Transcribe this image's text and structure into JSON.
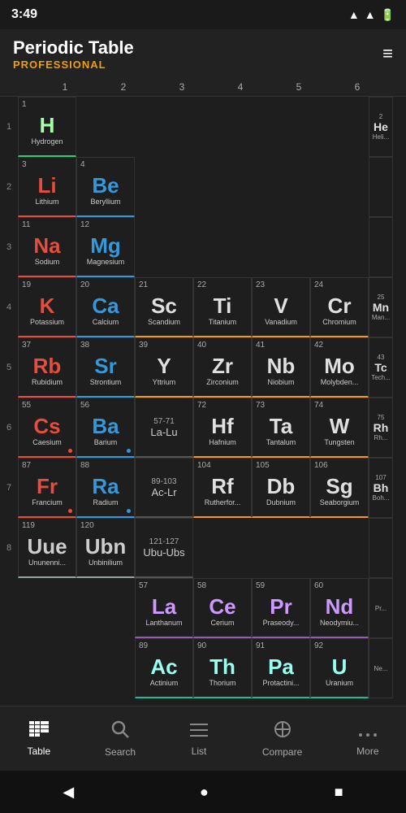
{
  "statusBar": {
    "time": "3:49"
  },
  "header": {
    "title": "Periodic Table",
    "subtitle": "PROFESSIONAL",
    "filterLabel": "filter"
  },
  "columns": [
    "1",
    "2",
    "3",
    "4",
    "5",
    "6"
  ],
  "rows": [
    {
      "rowNum": "1",
      "cells": [
        {
          "number": "1",
          "symbol": "H",
          "name": "Hydrogen",
          "type": "nonmetal",
          "col": 1
        },
        {
          "number": "",
          "symbol": "",
          "name": "",
          "type": "empty",
          "col": 2
        },
        {
          "number": "",
          "symbol": "",
          "name": "",
          "type": "empty",
          "col": 3
        },
        {
          "number": "",
          "symbol": "",
          "name": "",
          "type": "empty",
          "col": 4
        },
        {
          "number": "",
          "symbol": "",
          "name": "",
          "type": "empty",
          "col": 5
        },
        {
          "number": "",
          "symbol": "",
          "name": "",
          "type": "empty",
          "col": 6
        }
      ]
    },
    {
      "rowNum": "2",
      "cells": [
        {
          "number": "3",
          "symbol": "Li",
          "name": "Lithium",
          "type": "alkali-metal",
          "col": 1
        },
        {
          "number": "4",
          "symbol": "Be",
          "name": "Beryllium",
          "type": "alkaline-earth",
          "col": 2
        },
        {
          "number": "",
          "symbol": "",
          "name": "",
          "type": "empty",
          "col": 3
        },
        {
          "number": "",
          "symbol": "",
          "name": "",
          "type": "empty",
          "col": 4
        },
        {
          "number": "",
          "symbol": "",
          "name": "",
          "type": "empty",
          "col": 5
        },
        {
          "number": "",
          "symbol": "",
          "name": "",
          "type": "empty",
          "col": 6
        }
      ]
    },
    {
      "rowNum": "3",
      "cells": [
        {
          "number": "11",
          "symbol": "Na",
          "name": "Sodium",
          "type": "alkali-metal",
          "col": 1
        },
        {
          "number": "12",
          "symbol": "Mg",
          "name": "Magnesium",
          "type": "alkaline-earth",
          "col": 2
        },
        {
          "number": "",
          "symbol": "",
          "name": "",
          "type": "empty",
          "col": 3
        },
        {
          "number": "",
          "symbol": "",
          "name": "",
          "type": "empty",
          "col": 4
        },
        {
          "number": "",
          "symbol": "",
          "name": "",
          "type": "empty",
          "col": 5
        },
        {
          "number": "",
          "symbol": "",
          "name": "",
          "type": "empty",
          "col": 6
        }
      ]
    },
    {
      "rowNum": "4",
      "cells": [
        {
          "number": "19",
          "symbol": "K",
          "name": "Potassium",
          "type": "alkali-metal",
          "col": 1
        },
        {
          "number": "20",
          "symbol": "Ca",
          "name": "Calcium",
          "type": "alkaline-earth",
          "col": 2
        },
        {
          "number": "21",
          "symbol": "Sc",
          "name": "Scandium",
          "type": "transition",
          "col": 3
        },
        {
          "number": "22",
          "symbol": "Ti",
          "name": "Titanium",
          "type": "transition",
          "col": 4
        },
        {
          "number": "23",
          "symbol": "V",
          "name": "Vanadium",
          "type": "transition",
          "col": 5
        },
        {
          "number": "24",
          "symbol": "Cr",
          "name": "Chromium",
          "type": "transition",
          "col": 6
        }
      ]
    },
    {
      "rowNum": "5",
      "cells": [
        {
          "number": "37",
          "symbol": "Rb",
          "name": "Rubidium",
          "type": "alkali-metal",
          "col": 1
        },
        {
          "number": "38",
          "symbol": "Sr",
          "name": "Strontium",
          "type": "alkaline-earth",
          "col": 2
        },
        {
          "number": "39",
          "symbol": "Y",
          "name": "Yttrium",
          "type": "transition",
          "col": 3
        },
        {
          "number": "40",
          "symbol": "Zr",
          "name": "Zirconium",
          "type": "transition",
          "col": 4
        },
        {
          "number": "41",
          "symbol": "Nb",
          "name": "Niobium",
          "type": "transition",
          "col": 5
        },
        {
          "number": "42",
          "symbol": "Mo",
          "name": "Molybden...",
          "type": "transition",
          "col": 6
        }
      ]
    },
    {
      "rowNum": "6",
      "cells": [
        {
          "number": "55",
          "symbol": "Cs",
          "name": "Caesium",
          "type": "alkali-metal",
          "col": 1
        },
        {
          "number": "56",
          "symbol": "Ba",
          "name": "Barium",
          "type": "alkaline-earth",
          "col": 2
        },
        {
          "number": "57-71",
          "symbol": "La-Lu",
          "name": "",
          "type": "multi",
          "col": 3
        },
        {
          "number": "72",
          "symbol": "Hf",
          "name": "Hafnium",
          "type": "transition",
          "col": 4
        },
        {
          "number": "73",
          "symbol": "Ta",
          "name": "Tantalum",
          "type": "transition",
          "col": 5
        },
        {
          "number": "74",
          "symbol": "W",
          "name": "Tungsten",
          "type": "transition",
          "col": 6
        }
      ]
    },
    {
      "rowNum": "7",
      "cells": [
        {
          "number": "87",
          "symbol": "Fr",
          "name": "Francium",
          "type": "alkali-metal",
          "col": 1
        },
        {
          "number": "88",
          "symbol": "Ra",
          "name": "Radium",
          "type": "alkaline-earth",
          "col": 2
        },
        {
          "number": "89-103",
          "symbol": "Ac-Lr",
          "name": "",
          "type": "multi",
          "col": 3
        },
        {
          "number": "104",
          "symbol": "Rf",
          "name": "Rutherfor...",
          "type": "transition",
          "col": 4
        },
        {
          "number": "105",
          "symbol": "Db",
          "name": "Dubnium",
          "type": "transition",
          "col": 5
        },
        {
          "number": "106",
          "symbol": "Sg",
          "name": "Seaborgium",
          "type": "transition",
          "col": 6
        }
      ]
    },
    {
      "rowNum": "8",
      "cells": [
        {
          "number": "119",
          "symbol": "Uue",
          "name": "Ununenni...",
          "type": "unknown",
          "col": 1
        },
        {
          "number": "120",
          "symbol": "Ubn",
          "name": "Unbinilium",
          "type": "unknown",
          "col": 2
        },
        {
          "number": "121-127",
          "symbol": "Ubu-Ubs",
          "name": "",
          "type": "multi",
          "col": 3
        },
        {
          "number": "",
          "symbol": "",
          "name": "",
          "type": "empty",
          "col": 4
        },
        {
          "number": "",
          "symbol": "",
          "name": "",
          "type": "empty",
          "col": 5
        },
        {
          "number": "",
          "symbol": "",
          "name": "",
          "type": "empty",
          "col": 6
        }
      ]
    }
  ],
  "lanthanideRow": {
    "cells": [
      {
        "number": "57",
        "symbol": "La",
        "name": "Lanthanum",
        "type": "lanthanide"
      },
      {
        "number": "58",
        "symbol": "Ce",
        "name": "Cerium",
        "type": "lanthanide"
      },
      {
        "number": "59",
        "symbol": "Pr",
        "name": "Praseody...",
        "type": "lanthanide"
      },
      {
        "number": "60",
        "symbol": "Nd",
        "name": "Neodymiu...",
        "type": "lanthanide"
      }
    ]
  },
  "actinideRow": {
    "cells": [
      {
        "number": "89",
        "symbol": "Ac",
        "name": "Actinium",
        "type": "actinide"
      },
      {
        "number": "90",
        "symbol": "Th",
        "name": "Thorium",
        "type": "actinide"
      },
      {
        "number": "91",
        "symbol": "Pa",
        "name": "Protactini...",
        "type": "actinide"
      },
      {
        "number": "92",
        "symbol": "U",
        "name": "Uranium",
        "type": "actinide"
      }
    ]
  },
  "bottomNav": {
    "items": [
      {
        "label": "Table",
        "icon": "⊞",
        "active": true
      },
      {
        "label": "Search",
        "icon": "🔍",
        "active": false
      },
      {
        "label": "List",
        "icon": "☰",
        "active": false
      },
      {
        "label": "Compare",
        "icon": "⊕",
        "active": false
      },
      {
        "label": "More",
        "icon": "•••",
        "active": false
      }
    ]
  },
  "androidNav": {
    "back": "◀",
    "home": "●",
    "recent": "■"
  }
}
